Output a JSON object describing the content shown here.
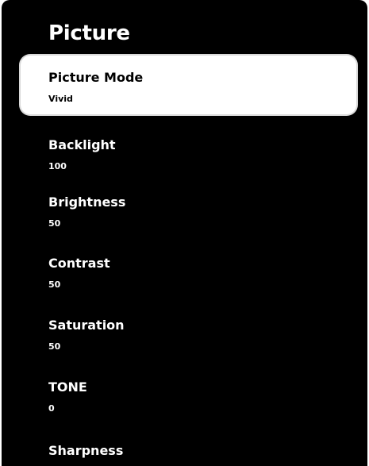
{
  "header": {
    "title": "Picture"
  },
  "menu": {
    "items": [
      {
        "label": "Picture Mode",
        "value": "Vivid",
        "selected": true
      },
      {
        "label": "Backlight",
        "value": "100",
        "selected": false
      },
      {
        "label": "Brightness",
        "value": "50",
        "selected": false
      },
      {
        "label": "Contrast",
        "value": "50",
        "selected": false
      },
      {
        "label": "Saturation",
        "value": "50",
        "selected": false
      },
      {
        "label": "TONE",
        "value": "0",
        "selected": false
      },
      {
        "label": "Sharpness",
        "value": "",
        "selected": false
      }
    ]
  },
  "colors": {
    "background": "#000000",
    "text": "#ffffff",
    "selected_background": "#ffffff",
    "selected_text": "#000000"
  }
}
